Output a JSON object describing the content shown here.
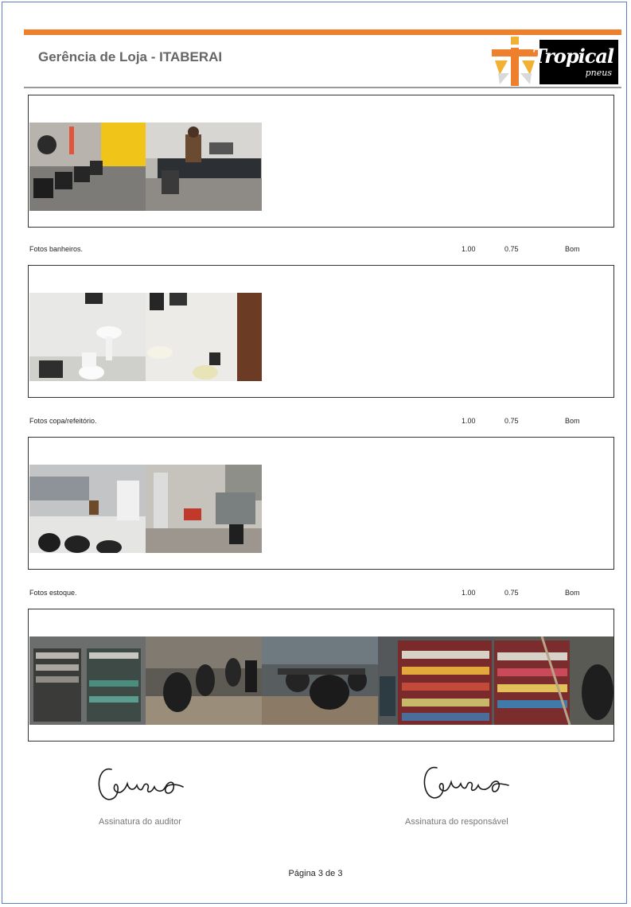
{
  "header": {
    "title": "Gerência de Loja - ITABERAI",
    "logo_word": "Tropical",
    "logo_sub": "pneus",
    "accent_color": "#ee7f2d"
  },
  "sections": [
    {
      "label": "Fotos banheiros.",
      "weight": "1.00",
      "score": "0.75",
      "rating": "Bom"
    },
    {
      "label": "Fotos copa/refeitório.",
      "weight": "1.00",
      "score": "0.75",
      "rating": "Bom"
    },
    {
      "label": "Fotos estoque.",
      "weight": "1.00",
      "score": "0.75",
      "rating": "Bom"
    }
  ],
  "signatures": {
    "auditor_label": "Assinatura do auditor",
    "auditor_signature": "Georgeo",
    "responsible_label": "Assinatura do responsável",
    "responsible_signature": "Georgea"
  },
  "footer": {
    "page_number": "Página 3 de 3"
  }
}
